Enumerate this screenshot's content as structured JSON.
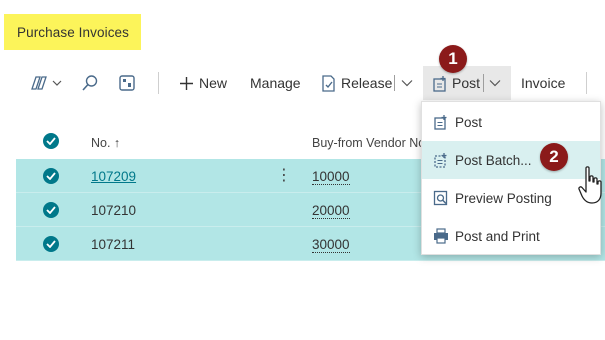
{
  "page": {
    "title": "Purchase Invoices"
  },
  "toolbar": {
    "new_label": "New",
    "manage_label": "Manage",
    "release_label": "Release",
    "post_label": "Post",
    "invoice_label": "Invoice",
    "icons": [
      "filter-pane-icon",
      "search-icon",
      "analysis-icon",
      "plus-icon",
      "release-icon",
      "post-icon",
      "chevron-down-icon"
    ]
  },
  "table": {
    "columns": {
      "no": "No. ↑",
      "vendor": "Buy-from Vendor No"
    },
    "rows": [
      {
        "no": "107209",
        "vendor": "10000",
        "selected": true
      },
      {
        "no": "107210",
        "vendor": "20000",
        "selected": true
      },
      {
        "no": "107211",
        "vendor": "30000",
        "selected": true
      }
    ]
  },
  "post_menu": {
    "items": [
      {
        "label": "Post"
      },
      {
        "label": "Post Batch..."
      },
      {
        "label": "Preview Posting"
      },
      {
        "label": "Post and Print"
      }
    ]
  },
  "badges": {
    "step1": "1",
    "step2": "2"
  },
  "colors": {
    "accent": "#00788a",
    "row_selected": "#b2e6e6",
    "title_highlight": "#fcf45a",
    "badge": "#8b1a1a"
  }
}
